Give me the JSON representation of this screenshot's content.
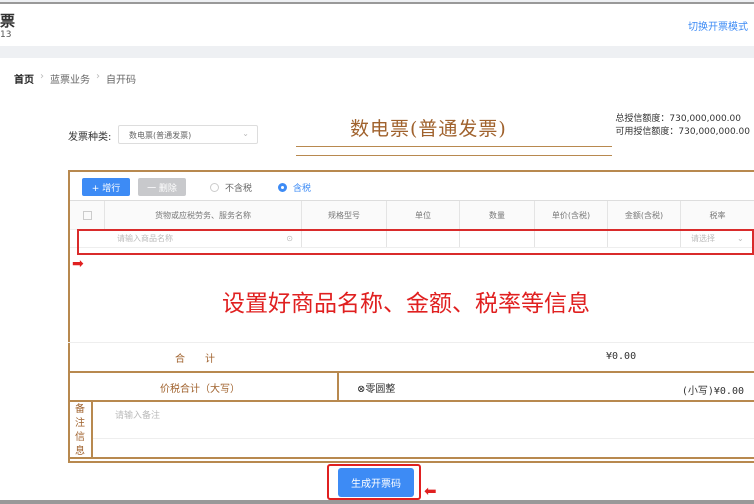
{
  "header": {
    "title": "票",
    "subtitle": "13",
    "switch_link": "切换开票模式"
  },
  "breadcrumb": [
    "首页",
    "蓝票业务",
    "自开码"
  ],
  "form": {
    "invoice_type_label": "发票种类:",
    "invoice_type_value": "数电票(普通发票)"
  },
  "invoice_title": "数电票(普通发票)",
  "credit": {
    "total": "总授信额度：730,000,000.00",
    "available": "可用授信额度：730,000,000.00"
  },
  "toolbar": {
    "add": "+ 增行",
    "delete": "一 删除",
    "tax_excluded": "不含税",
    "tax_included": "含税"
  },
  "table": {
    "columns": [
      "货物或应税劳务、服务名称",
      "规格型号",
      "单位",
      "数量",
      "单价(含税)",
      "金额(含税)",
      "税率"
    ],
    "row": {
      "name_placeholder": "请输入商品名称",
      "tax_placeholder": "请选择"
    }
  },
  "annotation": "设置好商品名称、金额、税率等信息",
  "totals": {
    "label": "合　　计",
    "amount": "¥0.00",
    "capital_label": "价税合计（大写）",
    "capital_value": "⊗零圆整",
    "small_value": "(小写)¥0.00"
  },
  "remarks": {
    "label": "备注信息",
    "placeholder": "请输入备注"
  },
  "generate_button": "生成开票码",
  "colors": {
    "accent": "#3d8bf5",
    "frame": "#b8894f",
    "highlight": "#e02020"
  }
}
